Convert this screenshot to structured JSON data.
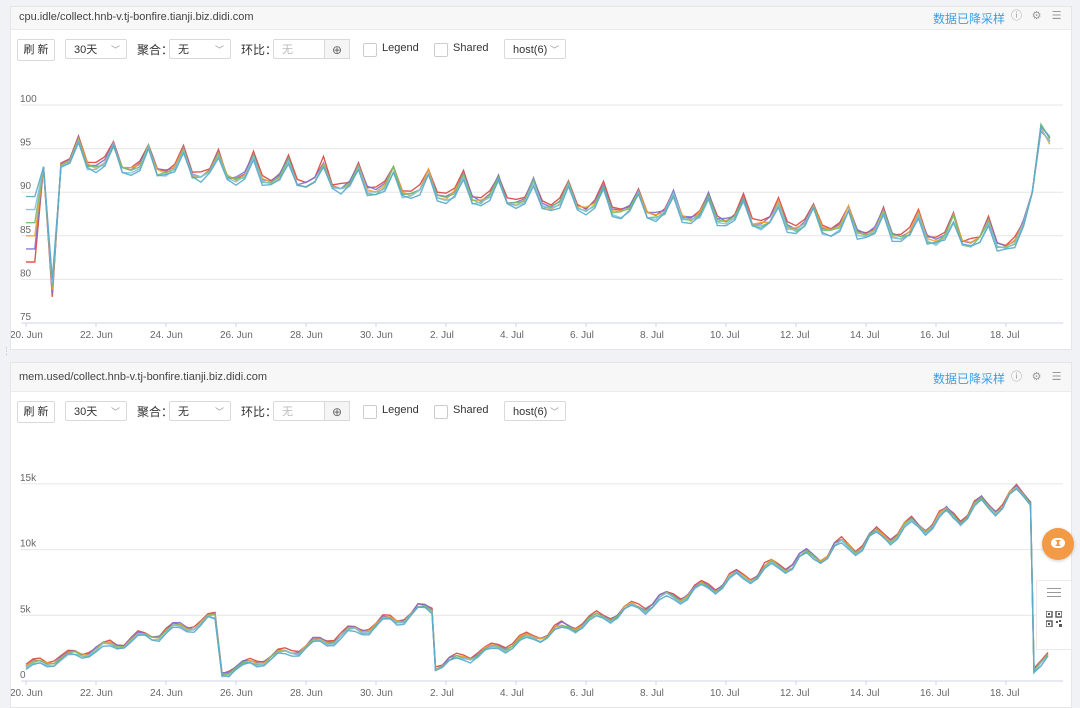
{
  "toolbar": {
    "refresh_label": "刷 新",
    "range_value": "30天",
    "aggregate_label": "聚合：",
    "aggregate_value": "无",
    "compare_label": "环比：",
    "compare_placeholder": "无",
    "plus_symbol": "⊕",
    "legend_label": "Legend",
    "shared_label": "Shared",
    "host_value": "host(6)"
  },
  "downsample_label": "数据已降采样",
  "colors": {
    "series": [
      "#d9453c",
      "#7b6fd0",
      "#f0a32a",
      "#6ec06e",
      "#7fc1df",
      "#5aa9c9"
    ],
    "accent": "#3aa0e6",
    "bubble": "#f39a46"
  },
  "icons": [
    "info-icon",
    "gear-icon",
    "menu-icon",
    "chevron-down-icon",
    "plus-circle-icon",
    "chat-bubble-icon",
    "qr-code-icon"
  ],
  "panels": [
    {
      "title": "cpu.idle/collect.hnb-v.tj-bonfire.tianji.biz.didi.com",
      "chart_data": {
        "type": "line",
        "x_ticks": [
          "20. Jun",
          "22. Jun",
          "24. Jun",
          "26. Jun",
          "28. Jun",
          "30. Jun",
          "2. Jul",
          "4. Jul",
          "6. Jul",
          "8. Jul",
          "10. Jul",
          "12. Jul",
          "14. Jul",
          "16. Jul",
          "18. Jul"
        ],
        "y_ticks": [
          "100",
          "95",
          "90",
          "85",
          "80",
          "75"
        ],
        "ylim": [
          75,
          100
        ],
        "xlim": [
          "2019-06-20",
          "2019-07-19"
        ],
        "series_count": 6,
        "points_per_day": 2,
        "trend": {
          "start_day_base": 94.5,
          "end_day_base": 84.5,
          "daily_peak_amplitude": 3.2,
          "dip_day": 20.5,
          "dip_value": 78,
          "end_spike_value": 98
        }
      }
    },
    {
      "title": "mem.used/collect.hnb-v.tj-bonfire.tianji.biz.didi.com",
      "chart_data": {
        "type": "line",
        "x_ticks": [
          "20. Jun",
          "22. Jun",
          "24. Jun",
          "26. Jun",
          "28. Jun",
          "30. Jun",
          "2. Jul",
          "4. Jul",
          "6. Jul",
          "8. Jul",
          "10. Jul",
          "12. Jul",
          "14. Jul",
          "16. Jul",
          "18. Jul"
        ],
        "y_ticks": [
          "15k",
          "10k",
          "5k",
          "0"
        ],
        "ylim": [
          0,
          17500
        ],
        "xlim": [
          "2019-06-20",
          "2019-07-19"
        ],
        "series_count": 6,
        "segments": [
          {
            "from": "2019-06-20",
            "to": "2019-06-25.6",
            "start": 1200,
            "end": 5000
          },
          {
            "from": "2019-06-25.6",
            "to": "2019-07-01.7",
            "start": 800,
            "end": 5800
          },
          {
            "from": "2019-07-01.7",
            "to": "2019-07-18.8",
            "start": 1300,
            "end": 14500
          },
          {
            "from": "2019-07-18.8",
            "to": "2019-07-19.3",
            "start": 1200,
            "end": 2000
          }
        ]
      }
    }
  ]
}
